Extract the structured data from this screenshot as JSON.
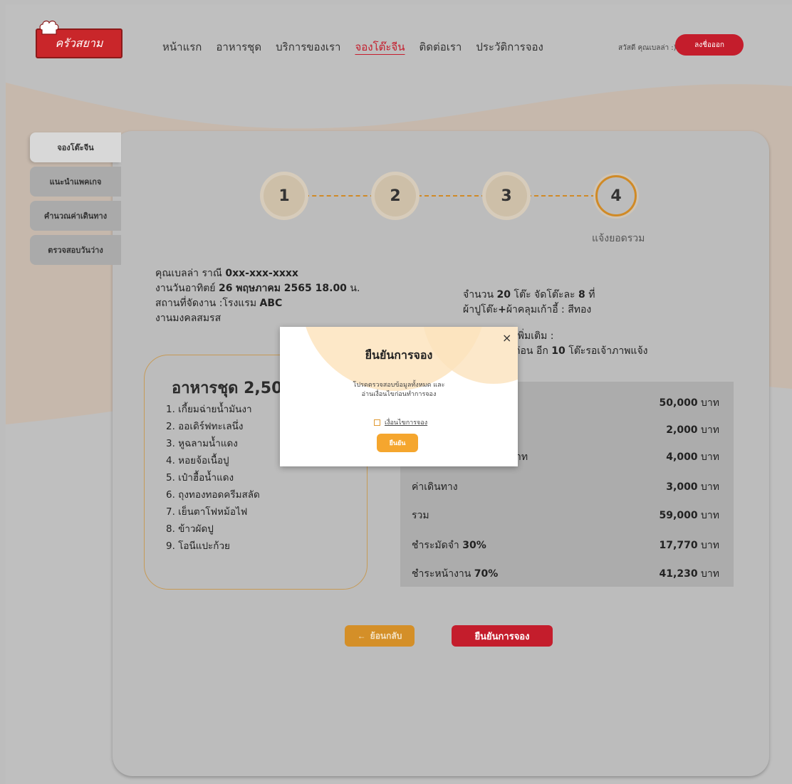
{
  "header": {
    "logo_text": "ครัวสยาม",
    "nav": [
      {
        "label": "หน้าแรก"
      },
      {
        "label": "อาหารชุด"
      },
      {
        "label": "บริการของเรา"
      },
      {
        "label": "จองโต๊ะจีน",
        "active": true
      },
      {
        "label": "ติดต่อเรา"
      },
      {
        "label": "ประวัติการจอง"
      }
    ],
    "greeting": "สวัสดี คุณเบลล่า :)",
    "logout_label": "ลงชื่อออก"
  },
  "sidebar": {
    "items": [
      {
        "label": "จองโต๊ะจีน",
        "active": true
      },
      {
        "label": "แนะนำแพคเกจ"
      },
      {
        "label": "คำนวณค่าเดินทาง"
      },
      {
        "label": "ตรวจสอบวันว่าง"
      }
    ]
  },
  "steps": {
    "items": [
      "1",
      "2",
      "3",
      "4"
    ],
    "current": 4,
    "current_label": "แจ้งยอดรวม"
  },
  "booking": {
    "customer_name": "คุณเบลล่า ราณี",
    "phone": "0xx-xxx-xxxx",
    "date_prefix": "งานวันอาทิตย์",
    "date": "26 พฤษภาคม 2565 18.00",
    "date_suffix": "น.",
    "venue_prefix": "สถานที่จัดงาน :โรงแรม",
    "venue": "ABC",
    "event_type": "งานมงคลสมรส",
    "tables_prefix": "จำนวน",
    "tables_count": "20",
    "tables_mid": "โต๊ะ จัดโต๊ะละ",
    "seats_per_table": "8",
    "tables_suffix": "ที่",
    "cloth_prefix": "ผ้าปูโต๊ะ",
    "cloth_bold": "+",
    "cloth_suffix": "ผ้าคลุมเก้าอี้ : สีทอง",
    "extra_label": "เพิ่มเติม :",
    "extra_note_prefix": "ก่อน อีก",
    "extra_note_count": "10",
    "extra_note_suffix": "โต๊ะรอเจ้าภาพแจ้ง"
  },
  "menu": {
    "title": "อาหารชุด 2,50",
    "items": [
      "1. เกี้ยมฉ่ายน้ำมันงา",
      "2. ออเดิร์ฟทะเลนึ่ง",
      "3. หูฉลามน้ำแดง",
      "4. หอยจ้อเนื้อปู",
      "5. เป๋าฮื้อน้ำแดง",
      "6. ถุงทองทอดครีมสลัด",
      "7. เย็นตาโฟหม้อไฟ",
      "8. ข้าวผัดปู",
      "9. โอนีแปะก้วย"
    ]
  },
  "prices": {
    "unit": "บาท",
    "rows": [
      {
        "label": "",
        "amount": "50,000"
      },
      {
        "label": "",
        "amount": "2,000"
      },
      {
        "label": "าท",
        "amount": "4,000"
      },
      {
        "label": "ค่าเดินทาง",
        "amount": "3,000"
      },
      {
        "label": "รวม",
        "amount": "59,000"
      },
      {
        "label": "ชำระมัดจำ",
        "label_bold": "30%",
        "amount": "17,770"
      },
      {
        "label": "ชำระหน้างาน",
        "label_bold": "70%",
        "amount": "41,230"
      }
    ]
  },
  "buttons": {
    "back_arrow": "←",
    "back_label": "ย้อนกลับ",
    "confirm_label": "ยืนยันการจอง"
  },
  "modal": {
    "title": "ยืนยันการจอง",
    "close": "×",
    "desc_line1": "โปรดตรวจสอบข้อมูลทั้งหมด และ",
    "desc_line2": "อ่านเงื่อนไขก่อนทำการจอง",
    "terms_link": "เงื่อนไขการจอง",
    "ok_label": "ยืนยัน"
  },
  "colors": {
    "brand_red": "#c41d2c",
    "accent_orange": "#d48f28",
    "modal_button": "#f5a62e"
  }
}
